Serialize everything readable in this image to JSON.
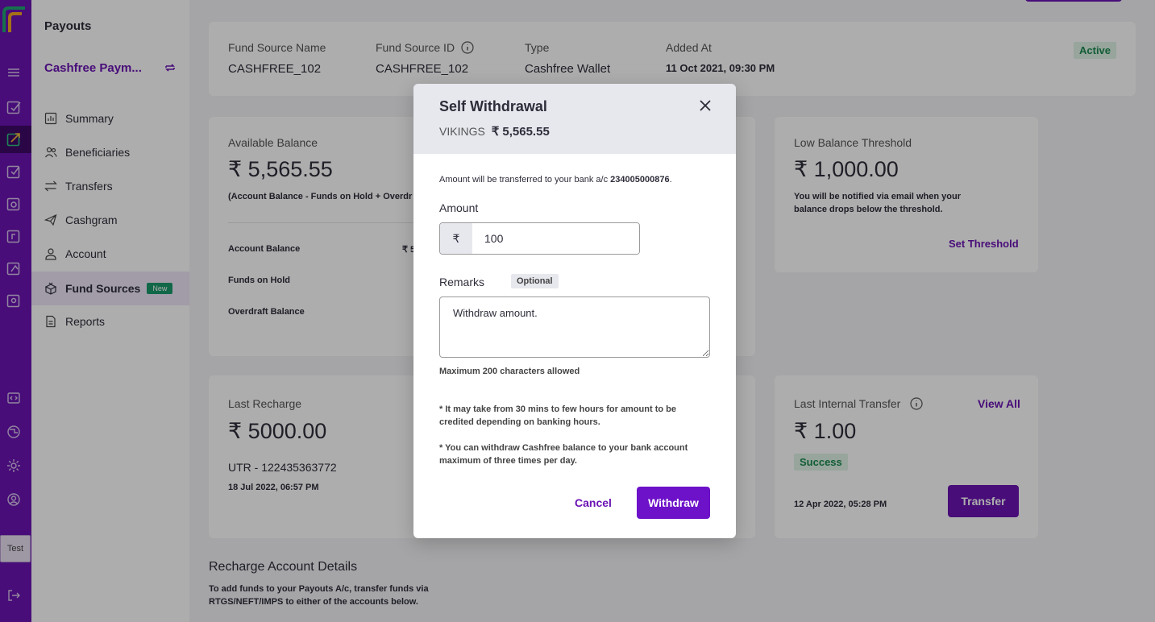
{
  "sidebar": {
    "title": "Payouts",
    "account_name": "Cashfree Paym...",
    "items": [
      {
        "label": "Summary",
        "icon": "chart-icon"
      },
      {
        "label": "Beneficiaries",
        "icon": "users-icon"
      },
      {
        "label": "Transfers",
        "icon": "transfer-arrows-icon"
      },
      {
        "label": "Cashgram",
        "icon": "send-icon"
      },
      {
        "label": "Account",
        "icon": "user-icon"
      },
      {
        "label": "Fund Sources",
        "icon": "box-icon",
        "badge": "New",
        "active": true
      },
      {
        "label": "Reports",
        "icon": "document-icon"
      }
    ]
  },
  "rail": {
    "env_label": "Test"
  },
  "fund_source": {
    "name_label": "Fund Source Name",
    "name_value": "CASHFREE_102",
    "id_label": "Fund Source ID",
    "id_value": "CASHFREE_102",
    "type_label": "Type",
    "type_value": "Cashfree Wallet",
    "added_label": "Added At",
    "added_value": "11 Oct 2021, 09:30 PM",
    "status": "Active"
  },
  "available_balance": {
    "label": "Available Balance",
    "value": "₹ 5,565.55",
    "note": "(Account Balance - Funds on Hold + Overdr",
    "rows": [
      {
        "label": "Account Balance",
        "value": "₹ 5"
      },
      {
        "label": "Funds on Hold",
        "value": ""
      },
      {
        "label": "Overdraft Balance",
        "value": ""
      }
    ]
  },
  "low_balance": {
    "label": "Low Balance Threshold",
    "value": "₹ 1,000.00",
    "note": "You will be notified via email when your balance drops below the threshold.",
    "action": "Set Threshold"
  },
  "last_recharge": {
    "label": "Last Recharge",
    "value": "₹ 5000.00",
    "utr": "UTR - 122435363772",
    "date": "18 Jul 2022, 06:57 PM"
  },
  "last_internal": {
    "label": "Last Internal Transfer",
    "view_all": "View All",
    "value": "₹ 1.00",
    "status": "Success",
    "date": "12 Apr 2022, 05:28 PM",
    "action": "Transfer"
  },
  "recharge_details": {
    "title": "Recharge Account Details",
    "text": "To add funds to your Payouts A/c, transfer funds via RTGS/NEFT/IMPS to either of the accounts below."
  },
  "modal": {
    "title": "Self Withdrawal",
    "account": "VIKINGS",
    "balance": "₹ 5,565.55",
    "info_prefix": "Amount will be transferred to your bank a/c ",
    "bank_account": "234005000876",
    "info_suffix": ".",
    "amount_label": "Amount",
    "currency_symbol": "₹",
    "amount_value": "100",
    "remarks_label": "Remarks",
    "optional_tag": "Optional",
    "remarks_value": "Withdraw amount.",
    "remarks_hint": "Maximum 200 characters allowed",
    "note1": "* It may take from 30 mins to few hours for amount to be credited depending on banking hours.",
    "note2": "* You can withdraw Cashfree balance to your bank account maximum of three times per day.",
    "cancel_label": "Cancel",
    "withdraw_label": "Withdraw"
  }
}
